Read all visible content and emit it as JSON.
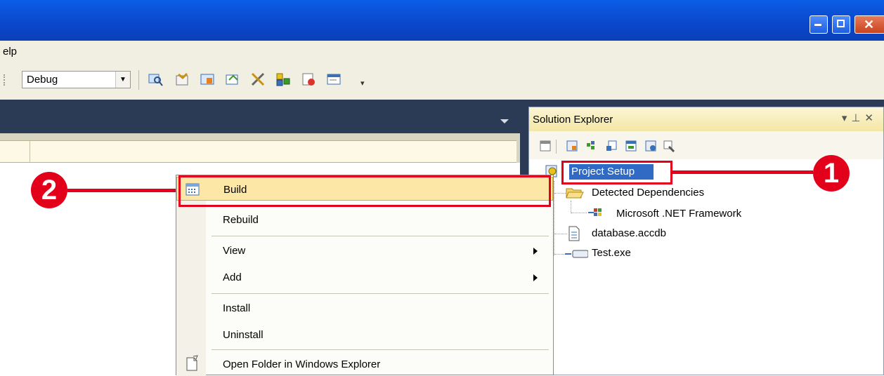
{
  "menubar": {
    "visible_text": "elp"
  },
  "toolbar": {
    "config_value": "Debug"
  },
  "solution_explorer": {
    "title": "Solution Explorer",
    "tree": {
      "project": "Project Setup",
      "items": [
        "Detected Dependencies",
        "Microsoft .NET Framework",
        "database.accdb",
        "Test.exe"
      ]
    }
  },
  "context_menu": {
    "items": [
      {
        "label": "Build"
      },
      {
        "label": "Rebuild"
      },
      {
        "label": "View"
      },
      {
        "label": "Add"
      },
      {
        "label": "Install"
      },
      {
        "label": "Uninstall"
      },
      {
        "label": "Open Folder in Windows Explorer"
      }
    ]
  },
  "annotations": {
    "badge_1": "1",
    "badge_2": "2"
  },
  "colors": {
    "accent_red": "#e3001b",
    "selection_blue": "#316ac5",
    "menu_highlight": "#fde7a6"
  }
}
